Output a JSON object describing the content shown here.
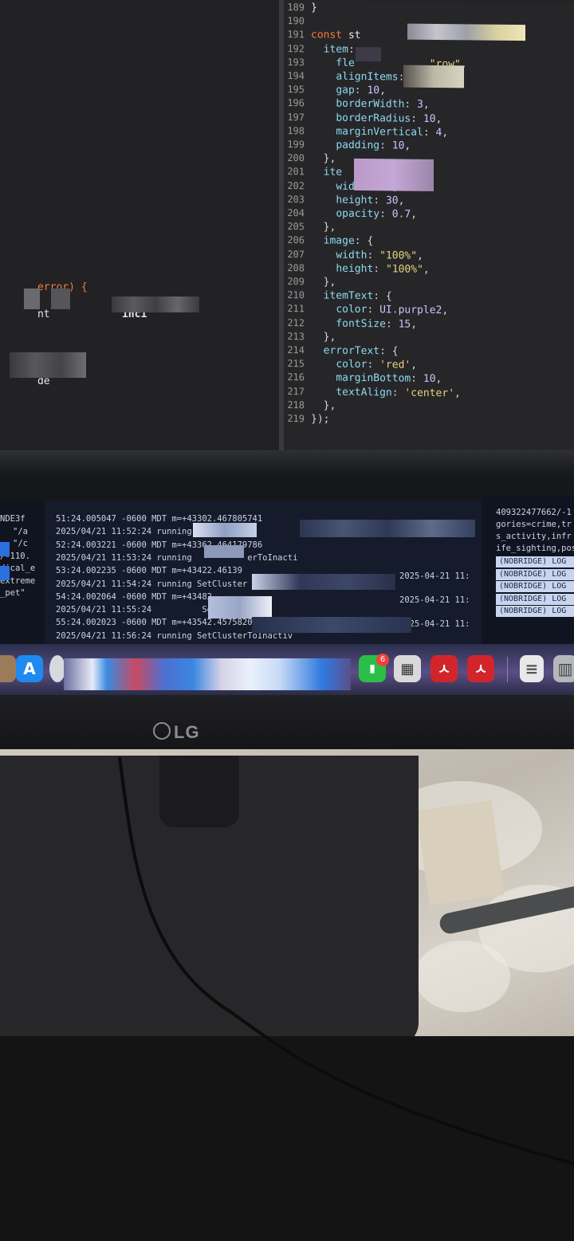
{
  "editor": {
    "right_lines": [
      {
        "n": "189",
        "html": "<span class='pale'>}</span>"
      },
      {
        "n": "190",
        "html": ""
      },
      {
        "n": "191",
        "html": "<span class='kw'>const</span> <span class='pale'>st</span>"
      },
      {
        "n": "192",
        "html": "  <span class='prop'>item</span>: -"
      },
      {
        "n": "193",
        "html": "    <span class='prop'>fle</span>            <span class='str'>\"row\"</span>,"
      },
      {
        "n": "194",
        "html": "    <span class='prop'>alignItems</span>:"
      },
      {
        "n": "195",
        "html": "    <span class='prop'>gap</span>: <span class='num'>10</span>,"
      },
      {
        "n": "196",
        "html": "    <span class='prop'>borderWidth</span>: <span class='num'>3</span>,"
      },
      {
        "n": "197",
        "html": "    <span class='prop'>borderRadius</span>: <span class='num'>10</span>,"
      },
      {
        "n": "198",
        "html": "    <span class='prop'>marginVertical</span>: <span class='num'>4</span>,"
      },
      {
        "n": "199",
        "html": "    <span class='prop'>padding</span>: <span class='num'>10</span>,"
      },
      {
        "n": "200",
        "html": "  },"
      },
      {
        "n": "201",
        "html": "  <span class='prop'>ite</span>             {"
      },
      {
        "n": "202",
        "html": "    <span class='prop'>width</span>: <span class='num'>30</span>,"
      },
      {
        "n": "203",
        "html": "    <span class='prop'>height</span>: <span class='num'>30</span>,"
      },
      {
        "n": "204",
        "html": "    <span class='prop'>opacity</span>: <span class='num'>0.7</span>,"
      },
      {
        "n": "205",
        "html": "  },"
      },
      {
        "n": "206",
        "html": "  <span class='prop'>image</span>: {"
      },
      {
        "n": "207",
        "html": "    <span class='prop'>width</span>: <span class='str'>\"100%\"</span>,"
      },
      {
        "n": "208",
        "html": "    <span class='prop'>height</span>: <span class='str'>\"100%\"</span>,"
      },
      {
        "n": "209",
        "html": "  },"
      },
      {
        "n": "210",
        "html": "  <span class='prop'>itemText</span>: {"
      },
      {
        "n": "211",
        "html": "    <span class='prop'>color</span>: <span class='num'>UI.purple2</span>,"
      },
      {
        "n": "212",
        "html": "    <span class='prop'>fontSize</span>: <span class='num'>15</span>,"
      },
      {
        "n": "213",
        "html": "  },"
      },
      {
        "n": "214",
        "html": "  <span class='prop'>errorText</span>: {"
      },
      {
        "n": "215",
        "html": "    <span class='prop'>color</span>: <span class='str'>'red'</span>,"
      },
      {
        "n": "216",
        "html": "    <span class='prop'>marginBottom</span>: <span class='num'>10</span>,"
      },
      {
        "n": "217",
        "html": "    <span class='prop'>textAlign</span>: <span class='str'>'center'</span>,"
      },
      {
        "n": "218",
        "html": "  },"
      },
      {
        "n": "219",
        "html": "});"
      }
    ],
    "left_snippets": {
      "error_fragment": "error) {",
      "nt_fragment": "nt",
      "inci_fragment": "inci",
      "de_fragment": "de"
    }
  },
  "terminal": {
    "left_lines": [
      "NDE3f",
      "\"/a",
      "\"/c",
      "/-110.",
      "dical_e",
      "extreme",
      "_pet\""
    ],
    "middle_lines": [
      "51:24.005047 -0600 MDT m=+43302.467805741",
      "2025/04/21 11:52:24 running                          tive",
      "52:24.003221 -0600 MDT m=+43362.464179786",
      "2025/04/21 11:53:24 running           erToInacti",
      "53:24.002235 -0600 MDT m=+43422.46139",
      "2025/04/21 11:54:24 running SetCluster",
      "54:24.002064 -0600 MDT m=+43482.",
      "2025/04/21 11:55:24          SetCluster",
      "55:24.002023 -0600 MDT m=+43542.457582094",
      "2025/04/21 11:56:24 running SetClusterToInactiv"
    ],
    "timestamps": [
      "2025-04-21 11:",
      "2025-04-21 11:",
      "2025-04-21 11:"
    ],
    "right_lines": [
      "409322477662/-1",
      "gories=crime,tr",
      "s_activity,infr",
      "ife_sighting,pos"
    ],
    "nobridge_lines": [
      "(NOBRIDGE) LOG",
      "(NOBRIDGE) LOG",
      "(NOBRIDGE) LOG",
      "(NOBRIDGE) LOG",
      "(NOBRIDGE) LOG"
    ]
  },
  "dock": {
    "facetime_badge": "6",
    "icons": [
      "app-store-icon",
      "facetime-icon",
      "calculator-icon",
      "acrobat-icon",
      "acrobat-icon",
      "document-icon",
      "trash-icon"
    ]
  },
  "monitor": {
    "brand": "LG"
  }
}
